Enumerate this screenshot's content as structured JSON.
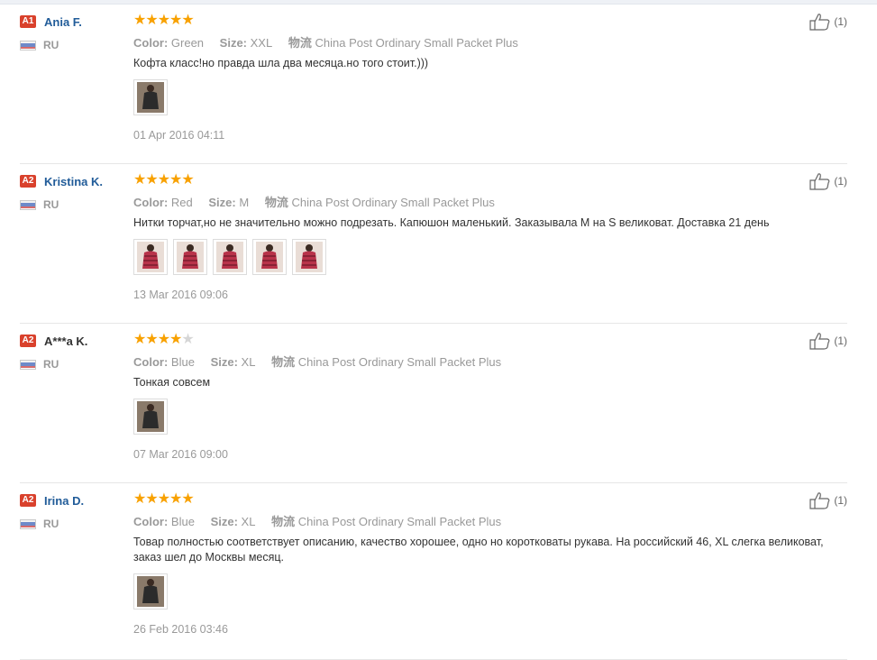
{
  "colors": {
    "accent_star": "#f8a100",
    "username": "#215c99",
    "badge": "#d9412c"
  },
  "labels": {
    "color": "Color:",
    "size": "Size:",
    "shipping": "物流"
  },
  "reviews": [
    {
      "badge": "A1",
      "name": "Ania F.",
      "country": "RU",
      "rating": 5,
      "color": "Green",
      "size": "XXL",
      "shipping": "China Post Ordinary Small Packet Plus",
      "text": "Кофта класс!но правда шла два месяца.но того стоит.)))",
      "photo_count": 1,
      "date": "01 Apr 2016 04:11",
      "likes": "(1)"
    },
    {
      "badge": "A2",
      "name": "Kristina K.",
      "country": "RU",
      "rating": 5,
      "color": "Red",
      "size": "M",
      "shipping": "China Post Ordinary Small Packet Plus",
      "text": "Нитки торчат,но не значительно можно подрезать. Капюшон маленький. Заказывала М на S великоват. Доставка 21 день",
      "photo_count": 5,
      "date": "13 Mar 2016 09:06",
      "likes": "(1)"
    },
    {
      "badge": "A2",
      "name": "A***a K.",
      "country": "RU",
      "rating": 4,
      "color": "Blue",
      "size": "XL",
      "shipping": "China Post Ordinary Small Packet Plus",
      "text": "Тонкая совсем",
      "photo_count": 1,
      "date": "07 Mar 2016 09:00",
      "likes": "(1)"
    },
    {
      "badge": "A2",
      "name": "Irina D.",
      "country": "RU",
      "rating": 5,
      "color": "Blue",
      "size": "XL",
      "shipping": "China Post Ordinary Small Packet Plus",
      "text": "Товар полностью соответствует описанию, качество хорошее, одно но коротковаты рукава. На российский 46, XL слегка великоват, заказ шел до Москвы месяц.",
      "photo_count": 1,
      "date": "26 Feb 2016 03:46",
      "likes": "(1)"
    }
  ]
}
